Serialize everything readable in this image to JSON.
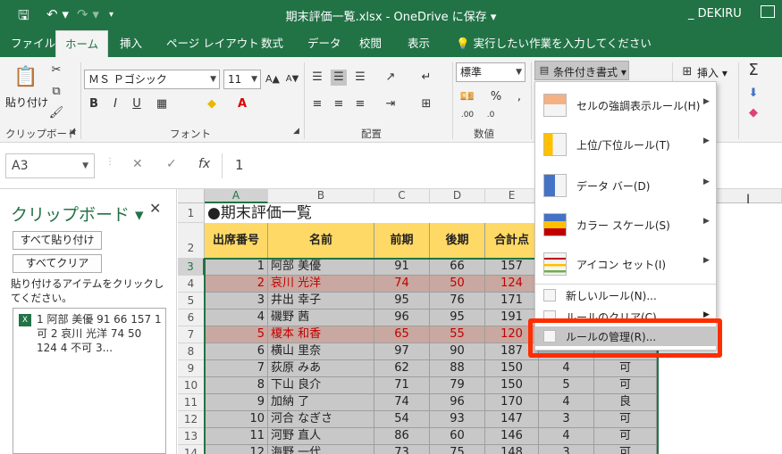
{
  "titlebar": {
    "title": "期末評価一覧.xlsx - OneDrive に保存 ▾",
    "user": "_ DEKIRU",
    "qa_save": "🖫",
    "qa_undo": "↶ ▾",
    "qa_redo": "↷ ▾",
    "qa_more": "▾"
  },
  "tabs": [
    "ファイル",
    "ホーム",
    "挿入",
    "ページ レイアウト",
    "数式",
    "データ",
    "校閲",
    "表示",
    "実行したい作業を入力してください"
  ],
  "ribbon": {
    "paste_label": "貼り付け",
    "clipboard_group": "クリップボード",
    "font_name": "ＭＳ Ｐゴシック",
    "font_size": "11",
    "font_group": "フォント",
    "align_group": "配置",
    "number_format": "標準",
    "number_group": "数値",
    "cond_format": "条件付き書式 ▾",
    "insert_label": "挿入 ▾",
    "bold": "B",
    "italic": "I",
    "underline": "U"
  },
  "formula": {
    "namebox": "A3",
    "value": "1",
    "cancel": "✕",
    "enter": "✓",
    "fx": "fx"
  },
  "pane": {
    "title": "クリップボード ▾",
    "close": "✕",
    "paste_all": "すべて貼り付け",
    "clear_all": "すべてクリア",
    "hint": "貼り付けるアイテムをクリックしてください。",
    "item_text": "1 阿部 美優 91 66 157 1 可 2 哀川 光洋 74 50 124 4 不可 3...",
    "item_icon": "X"
  },
  "sheet": {
    "columns": [
      "A",
      "B",
      "C",
      "D",
      "E"
    ],
    "title_row": "●期末評価一覧",
    "headers": [
      "出席番号",
      "名前",
      "前期",
      "後期",
      "合計点"
    ],
    "rows": [
      {
        "row": "3",
        "no": "1",
        "name": "阿部 美優",
        "first": "91",
        "second": "66",
        "total": "157",
        "rank": "",
        "grade": "",
        "style": "gray"
      },
      {
        "row": "4",
        "no": "2",
        "name": "哀川 光洋",
        "first": "74",
        "second": "50",
        "total": "124",
        "rank": "",
        "grade": "",
        "style": "pink"
      },
      {
        "row": "5",
        "no": "3",
        "name": "井出 幸子",
        "first": "95",
        "second": "76",
        "total": "171",
        "rank": "",
        "grade": "",
        "style": "gray"
      },
      {
        "row": "6",
        "no": "4",
        "name": "磯野 茜",
        "first": "96",
        "second": "95",
        "total": "191",
        "rank": "",
        "grade": "",
        "style": "gray"
      },
      {
        "row": "7",
        "no": "5",
        "name": "榎本 和香",
        "first": "65",
        "second": "55",
        "total": "120",
        "rank": "",
        "grade": "",
        "style": "pink"
      },
      {
        "row": "8",
        "no": "6",
        "name": "横山 里奈",
        "first": "97",
        "second": "90",
        "total": "187",
        "rank": "",
        "grade": "",
        "style": "gray"
      },
      {
        "row": "9",
        "no": "7",
        "name": "荻原 みあ",
        "first": "62",
        "second": "88",
        "total": "150",
        "rank": "4",
        "grade": "可",
        "style": "gray"
      },
      {
        "row": "10",
        "no": "8",
        "name": "下山 良介",
        "first": "71",
        "second": "79",
        "total": "150",
        "rank": "5",
        "grade": "可",
        "style": "gray"
      },
      {
        "row": "11",
        "no": "9",
        "name": "加納 了",
        "first": "74",
        "second": "96",
        "total": "170",
        "rank": "4",
        "grade": "良",
        "style": "gray"
      },
      {
        "row": "12",
        "no": "10",
        "name": "河合 なぎさ",
        "first": "54",
        "second": "93",
        "total": "147",
        "rank": "3",
        "grade": "可",
        "style": "gray"
      },
      {
        "row": "13",
        "no": "11",
        "name": "河野 直人",
        "first": "86",
        "second": "60",
        "total": "146",
        "rank": "4",
        "grade": "可",
        "style": "gray"
      },
      {
        "row": "14",
        "no": "12",
        "name": "海野 一代",
        "first": "73",
        "second": "75",
        "total": "148",
        "rank": "3",
        "grade": "可",
        "style": "gray"
      }
    ]
  },
  "menu": {
    "items": [
      {
        "label": "セルの強調表示ルール(H)",
        "icon": "highlight-rules-icon"
      },
      {
        "label": "上位/下位ルール(T)",
        "icon": "top-bottom-rules-icon"
      },
      {
        "label": "データ バー(D)",
        "icon": "data-bars-icon"
      },
      {
        "label": "カラー スケール(S)",
        "icon": "color-scales-icon"
      },
      {
        "label": "アイコン セット(I)",
        "icon": "icon-sets-icon"
      }
    ],
    "new_rule": "新しいルール(N)...",
    "clear_rules": "ルールのクリア(C)",
    "manage_rules": "ルールの管理(R)...",
    "arrow": "▶"
  },
  "colors": {
    "excel_green": "#217346",
    "header_yellow": "#ffd966",
    "alert_red": "#ff2d00"
  }
}
